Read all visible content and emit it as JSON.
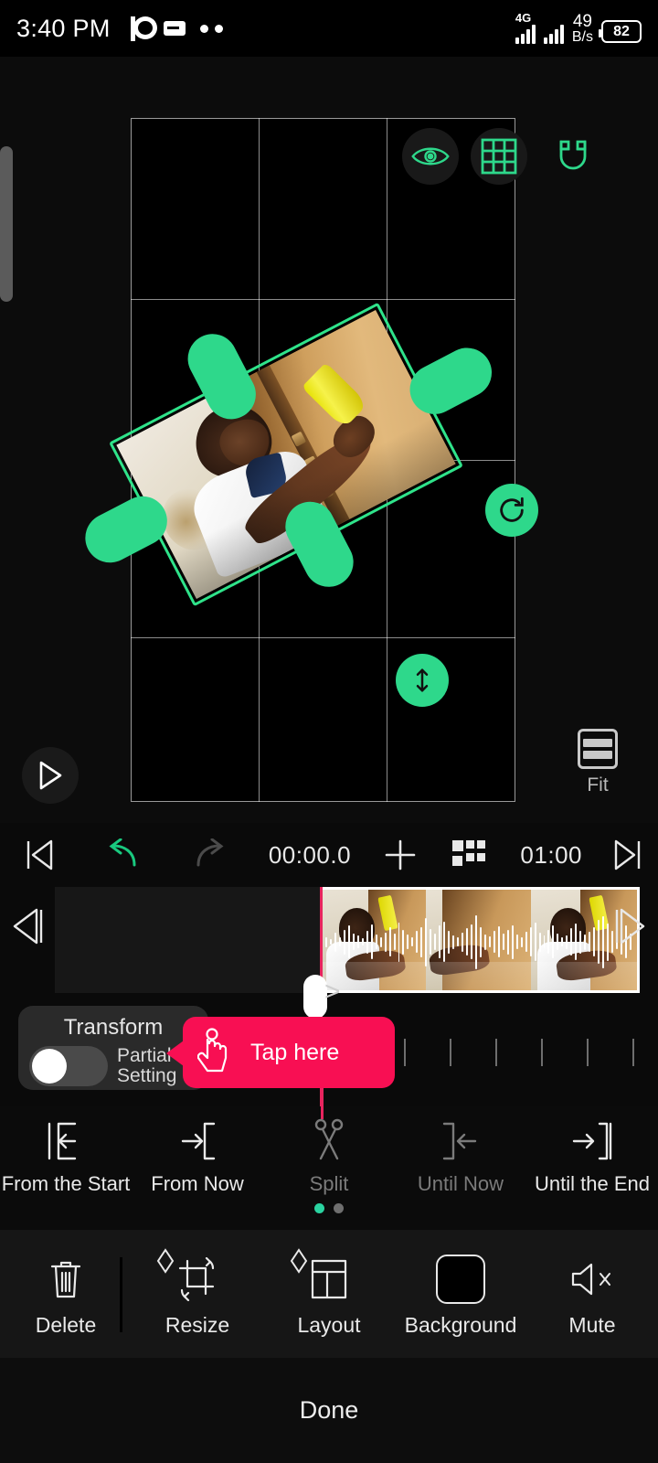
{
  "status_bar": {
    "time": "3:40 PM",
    "network_type": "4G",
    "net_speed_value": "49",
    "net_speed_unit": "B/s",
    "battery_level": "82",
    "icons": [
      "pandora-icon",
      "message-icon",
      "more-dots-icon"
    ]
  },
  "preview": {
    "overlay_icons": [
      {
        "name": "eye-icon",
        "label": "Preview"
      },
      {
        "name": "grid-icon",
        "label": "Grid"
      },
      {
        "name": "magnet-icon",
        "label": "Snap"
      }
    ],
    "play_label": "Play",
    "fit_label": "Fit",
    "accent_green": "#2ed88b",
    "selection_handles": [
      "rotate-handle",
      "flip-handle",
      "edge-handle-left",
      "edge-handle-top",
      "edge-handle-bottom",
      "edge-handle-right"
    ]
  },
  "timeline_toolbar": {
    "prev_frame": "prev-frame-icon",
    "undo": "undo-icon",
    "redo": "redo-icon",
    "current_time": "00:00.0",
    "add": "add-icon",
    "grid_view": "grid-view-icon",
    "total_time": "01:00",
    "next_frame": "next-frame-icon"
  },
  "timeline": {
    "expand_chevron": ">",
    "playhead_position": "00:00.0"
  },
  "transform_popup": {
    "title": "Transform",
    "toggle_state": "off",
    "toggle_label_line1": "Partial",
    "toggle_label_line2": "Setting"
  },
  "tooltip": {
    "text": "Tap here",
    "icon": "tap-hand-icon",
    "color": "#f80f53"
  },
  "trim_actions": [
    {
      "label": "From the Start",
      "icon": "trim-from-start-icon",
      "enabled": true
    },
    {
      "label": "From Now",
      "icon": "trim-from-now-icon",
      "enabled": true
    },
    {
      "label": "Split",
      "icon": "scissors-icon",
      "enabled": false
    },
    {
      "label": "Until Now",
      "icon": "trim-until-now-icon",
      "enabled": false
    },
    {
      "label": "Until the End",
      "icon": "trim-until-end-icon",
      "enabled": true
    }
  ],
  "page_dots": {
    "count": 2,
    "active_index": 0,
    "active_color": "#2ad3a0"
  },
  "bottom_toolbar": [
    {
      "label": "Delete",
      "icon": "trash-icon",
      "keyframe": false
    },
    {
      "label": "Resize",
      "icon": "crop-rotate-icon",
      "keyframe": true
    },
    {
      "label": "Layout",
      "icon": "layout-icon",
      "keyframe": true
    },
    {
      "label": "Background",
      "icon": "background-icon",
      "keyframe": false
    },
    {
      "label": "Mute",
      "icon": "mute-icon",
      "keyframe": false
    }
  ],
  "footer": {
    "done_label": "Done"
  }
}
